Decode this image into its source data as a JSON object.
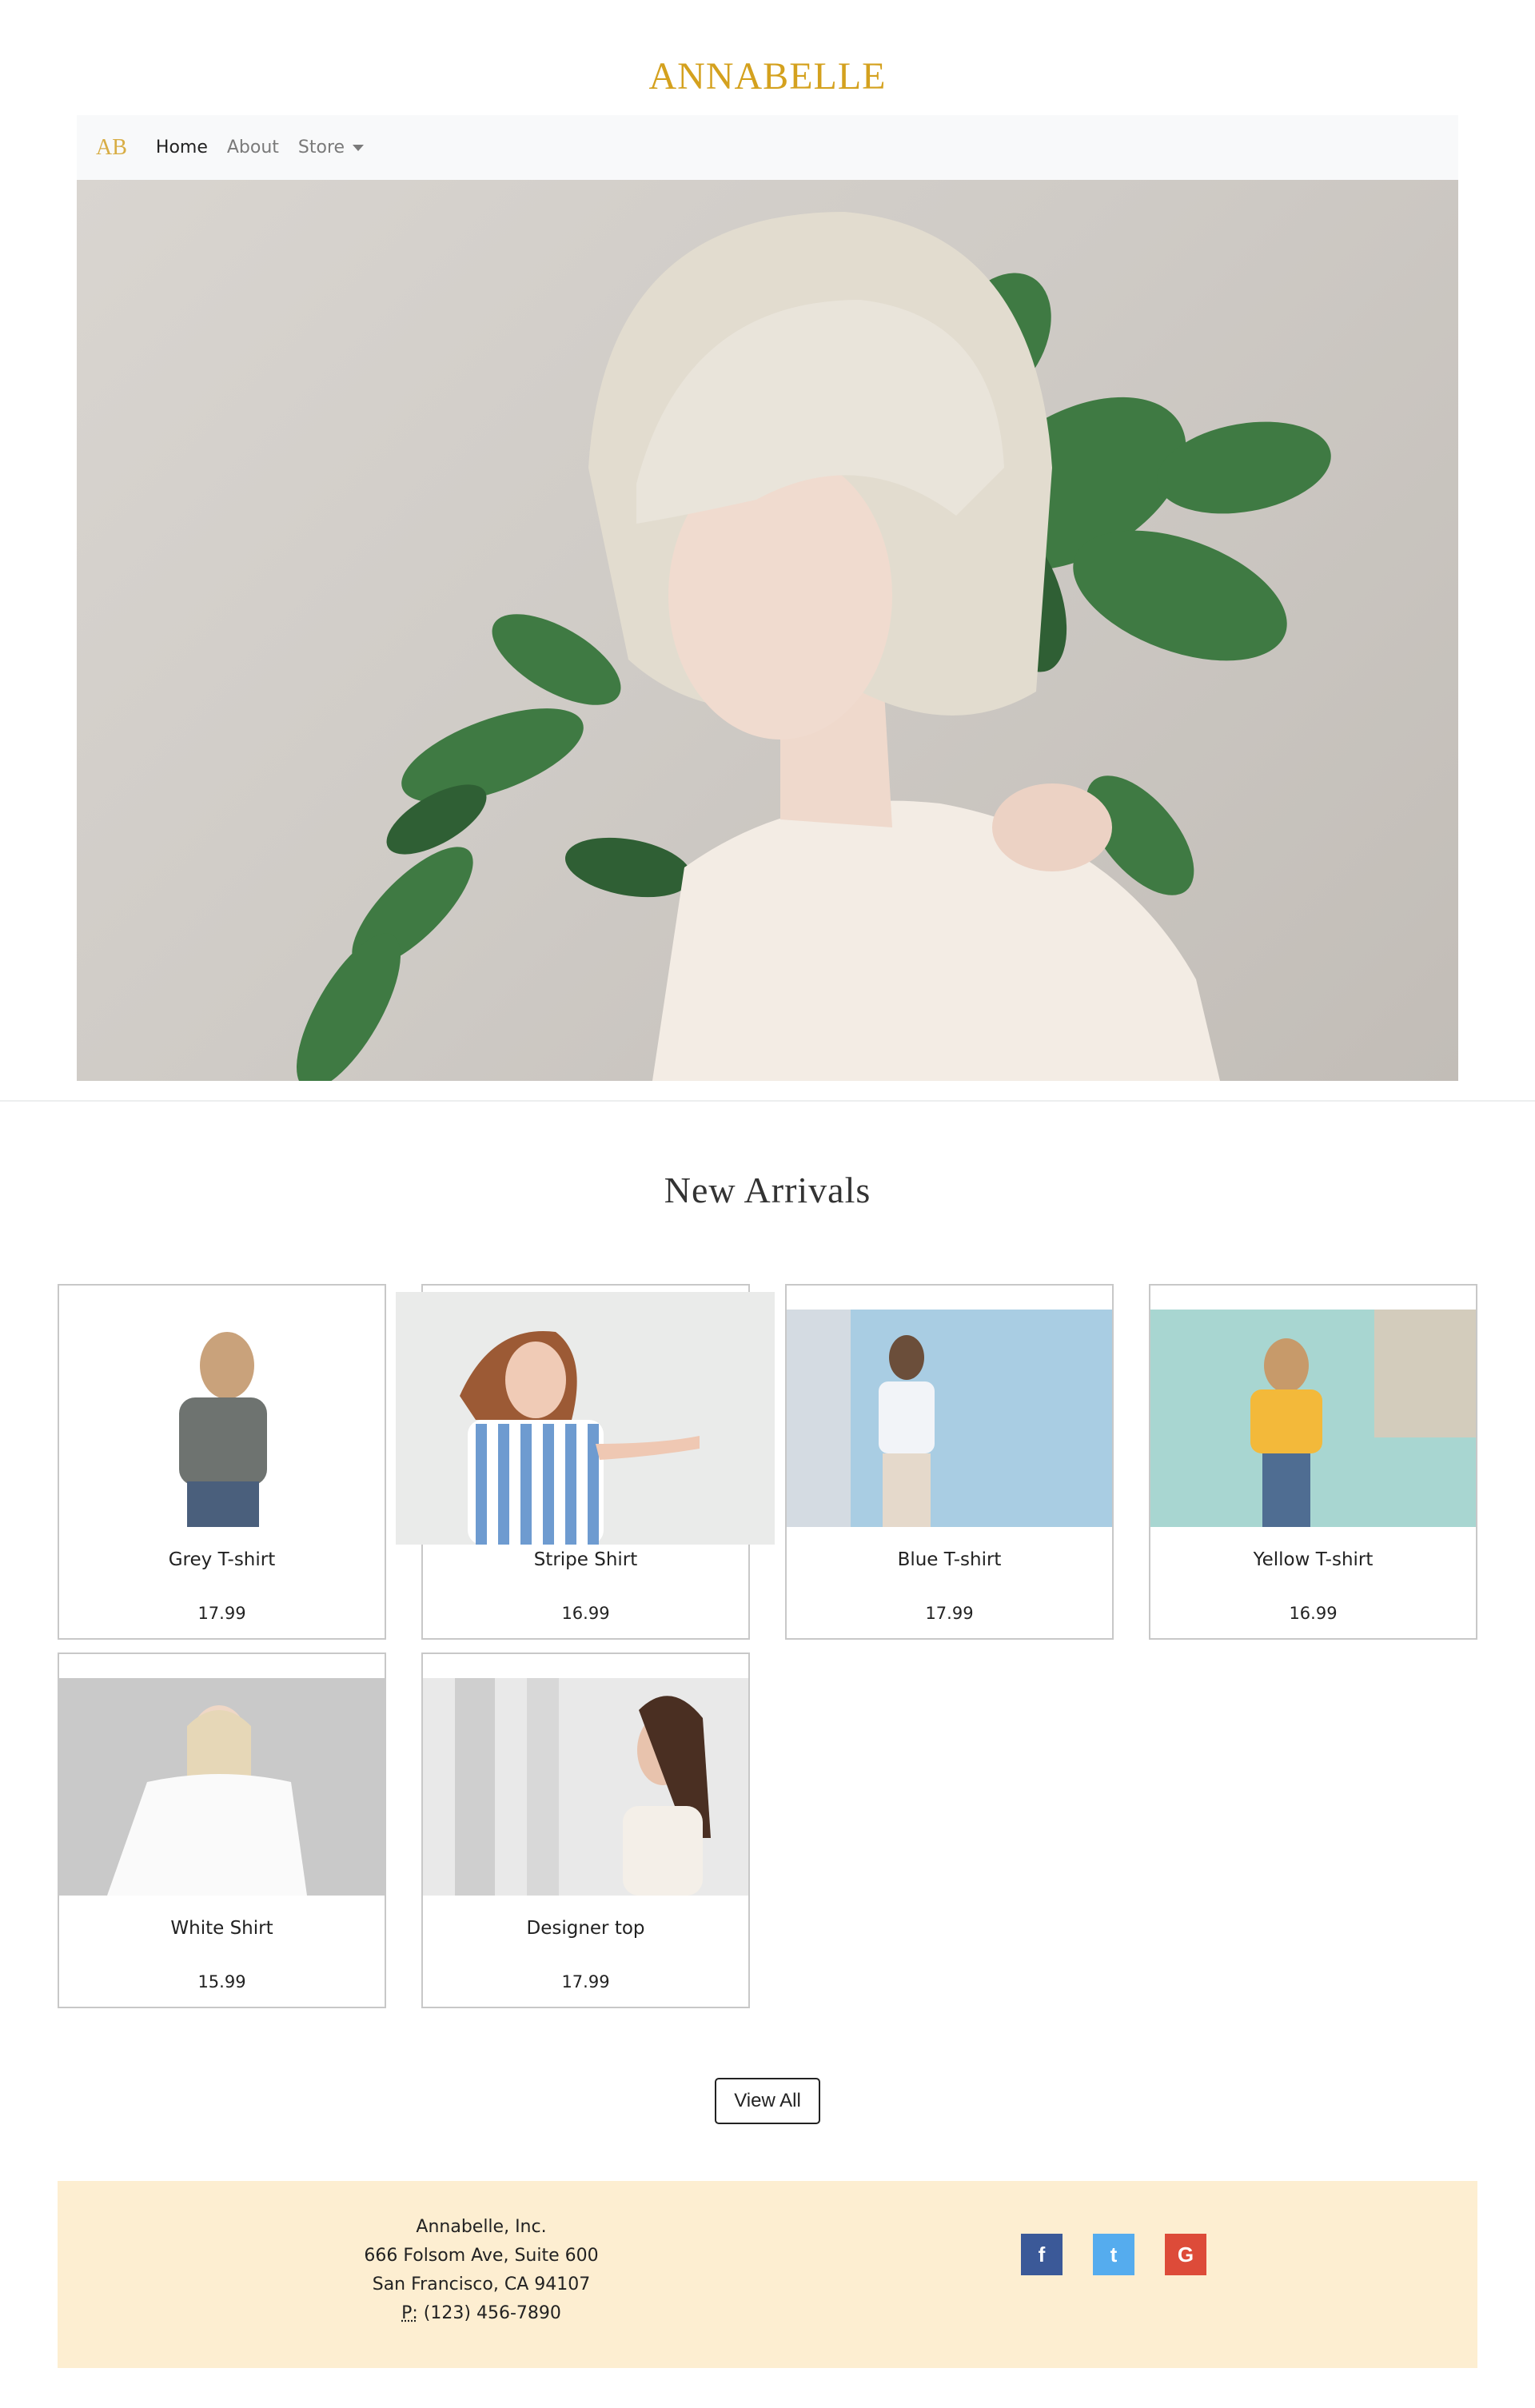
{
  "site": {
    "title": "ANNABELLE"
  },
  "nav": {
    "brand": "AB",
    "items": [
      {
        "label": "Home",
        "active": true
      },
      {
        "label": "About",
        "active": false
      },
      {
        "label": "Store",
        "active": false,
        "dropdown": true
      }
    ]
  },
  "hero": {
    "image_subject": "woman with platinum bob holding green leaves"
  },
  "new_arrivals": {
    "heading": "New Arrivals",
    "products": [
      {
        "name": "Grey T-shirt",
        "price": "17.99"
      },
      {
        "name": "Stripe Shirt",
        "price": "16.99"
      },
      {
        "name": "Blue T-shirt",
        "price": "17.99"
      },
      {
        "name": "Yellow T-shirt",
        "price": "16.99"
      },
      {
        "name": "White Shirt",
        "price": "15.99"
      },
      {
        "name": "Designer top",
        "price": "17.99"
      }
    ],
    "view_all_label": "View All"
  },
  "footer": {
    "company": "Annabelle, Inc.",
    "street": "666 Folsom Ave, Suite 600",
    "city": "San Francisco, CA 94107",
    "phone_label": "P:",
    "phone": "(123) 456-7890",
    "social": [
      {
        "icon": "facebook-icon",
        "glyph": "f",
        "color": "#3b5998"
      },
      {
        "icon": "twitter-icon",
        "glyph": "t",
        "color": "#55acee"
      },
      {
        "icon": "google-icon",
        "glyph": "G",
        "color": "#dd4b39"
      }
    ]
  },
  "colors": {
    "brand": "#d4a11e",
    "footer_bg": "#fdeed1",
    "nav_bg": "#f8f9fa"
  }
}
